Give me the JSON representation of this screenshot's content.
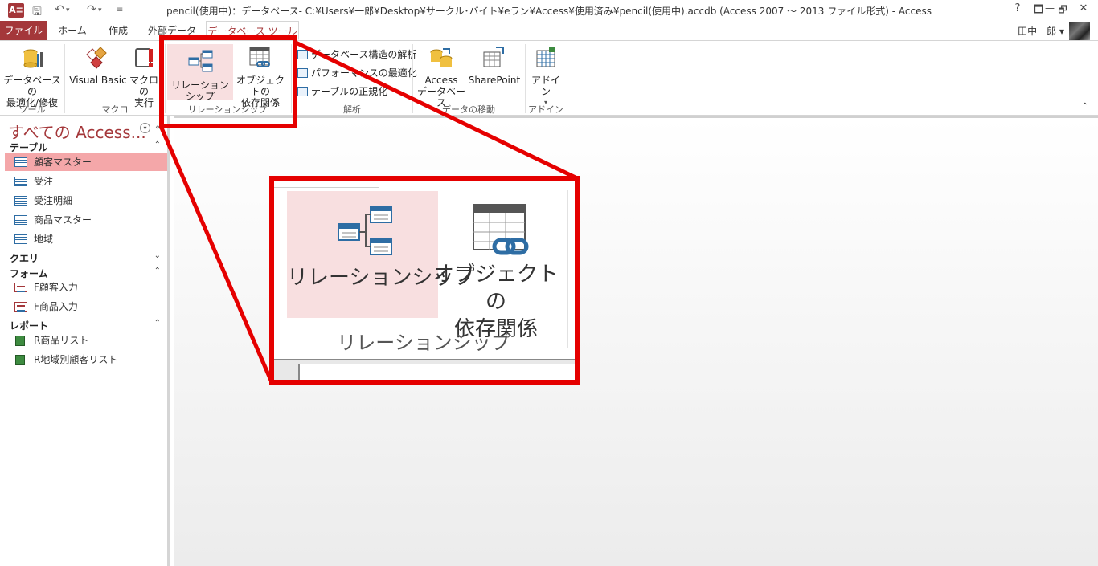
{
  "titlebar": {
    "app_icon": "A≡",
    "title": "pencil(使用中)：データベース- C:¥Users¥一郎¥Desktop¥サークル･バイト¥eラン¥Access¥使用済み¥pencil(使用中).accdb (Access 2007 ～ 2013 ファイル形式) - Access",
    "help": "?",
    "restore": "🗗",
    "minimize": "—",
    "close": "✕"
  },
  "tabs": {
    "file": "ファイル",
    "home": "ホーム",
    "create": "作成",
    "external": "外部データ",
    "dbtools": "データベース ツール"
  },
  "user": {
    "name": "田中一郎 ▾"
  },
  "ribbon": {
    "compact_label": "データベースの\n最適化/修復",
    "tools_group": "ツール",
    "vb_label": "Visual Basic",
    "macro_run_label": "マクロの\n実行",
    "macro_group": "マクロ",
    "relationships_label": "リレーションシップ",
    "objdep_label": "オブジェクトの\n依存関係",
    "relationships_group": "リレーションシップ",
    "analyze_db_label": "データベース構造の解析",
    "perf_label": "パフォーマンスの最適化",
    "normalize_label": "テーブルの正規化",
    "analyze_group": "解析",
    "access_db_label": "Access\nデータベース",
    "sharepoint_label": "SharePoint",
    "move_group": "データの移動",
    "addin_label": "アドイン",
    "addin_group": "アドイン"
  },
  "nav": {
    "title": "すべての Access...",
    "sections": {
      "tables": "テーブル",
      "queries": "クエリ",
      "forms": "フォーム",
      "reports": "レポート"
    },
    "tables": [
      "顧客マスター",
      "受注",
      "受注明細",
      "商品マスター",
      "地域"
    ],
    "forms": [
      "F顧客入力",
      "F商品入力"
    ],
    "reports": [
      "R商品リスト",
      "R地域別顧客リスト"
    ]
  },
  "zoom": {
    "relationships_label": "リレーションシップ",
    "objdep_label_line1": "オブジェクトの",
    "objdep_label_line2": "依存関係",
    "group_label": "リレーションシップ"
  },
  "colors": {
    "accent": "#a4373a",
    "highlight_red": "#e50000",
    "selected_item": "#f4a7a9"
  }
}
